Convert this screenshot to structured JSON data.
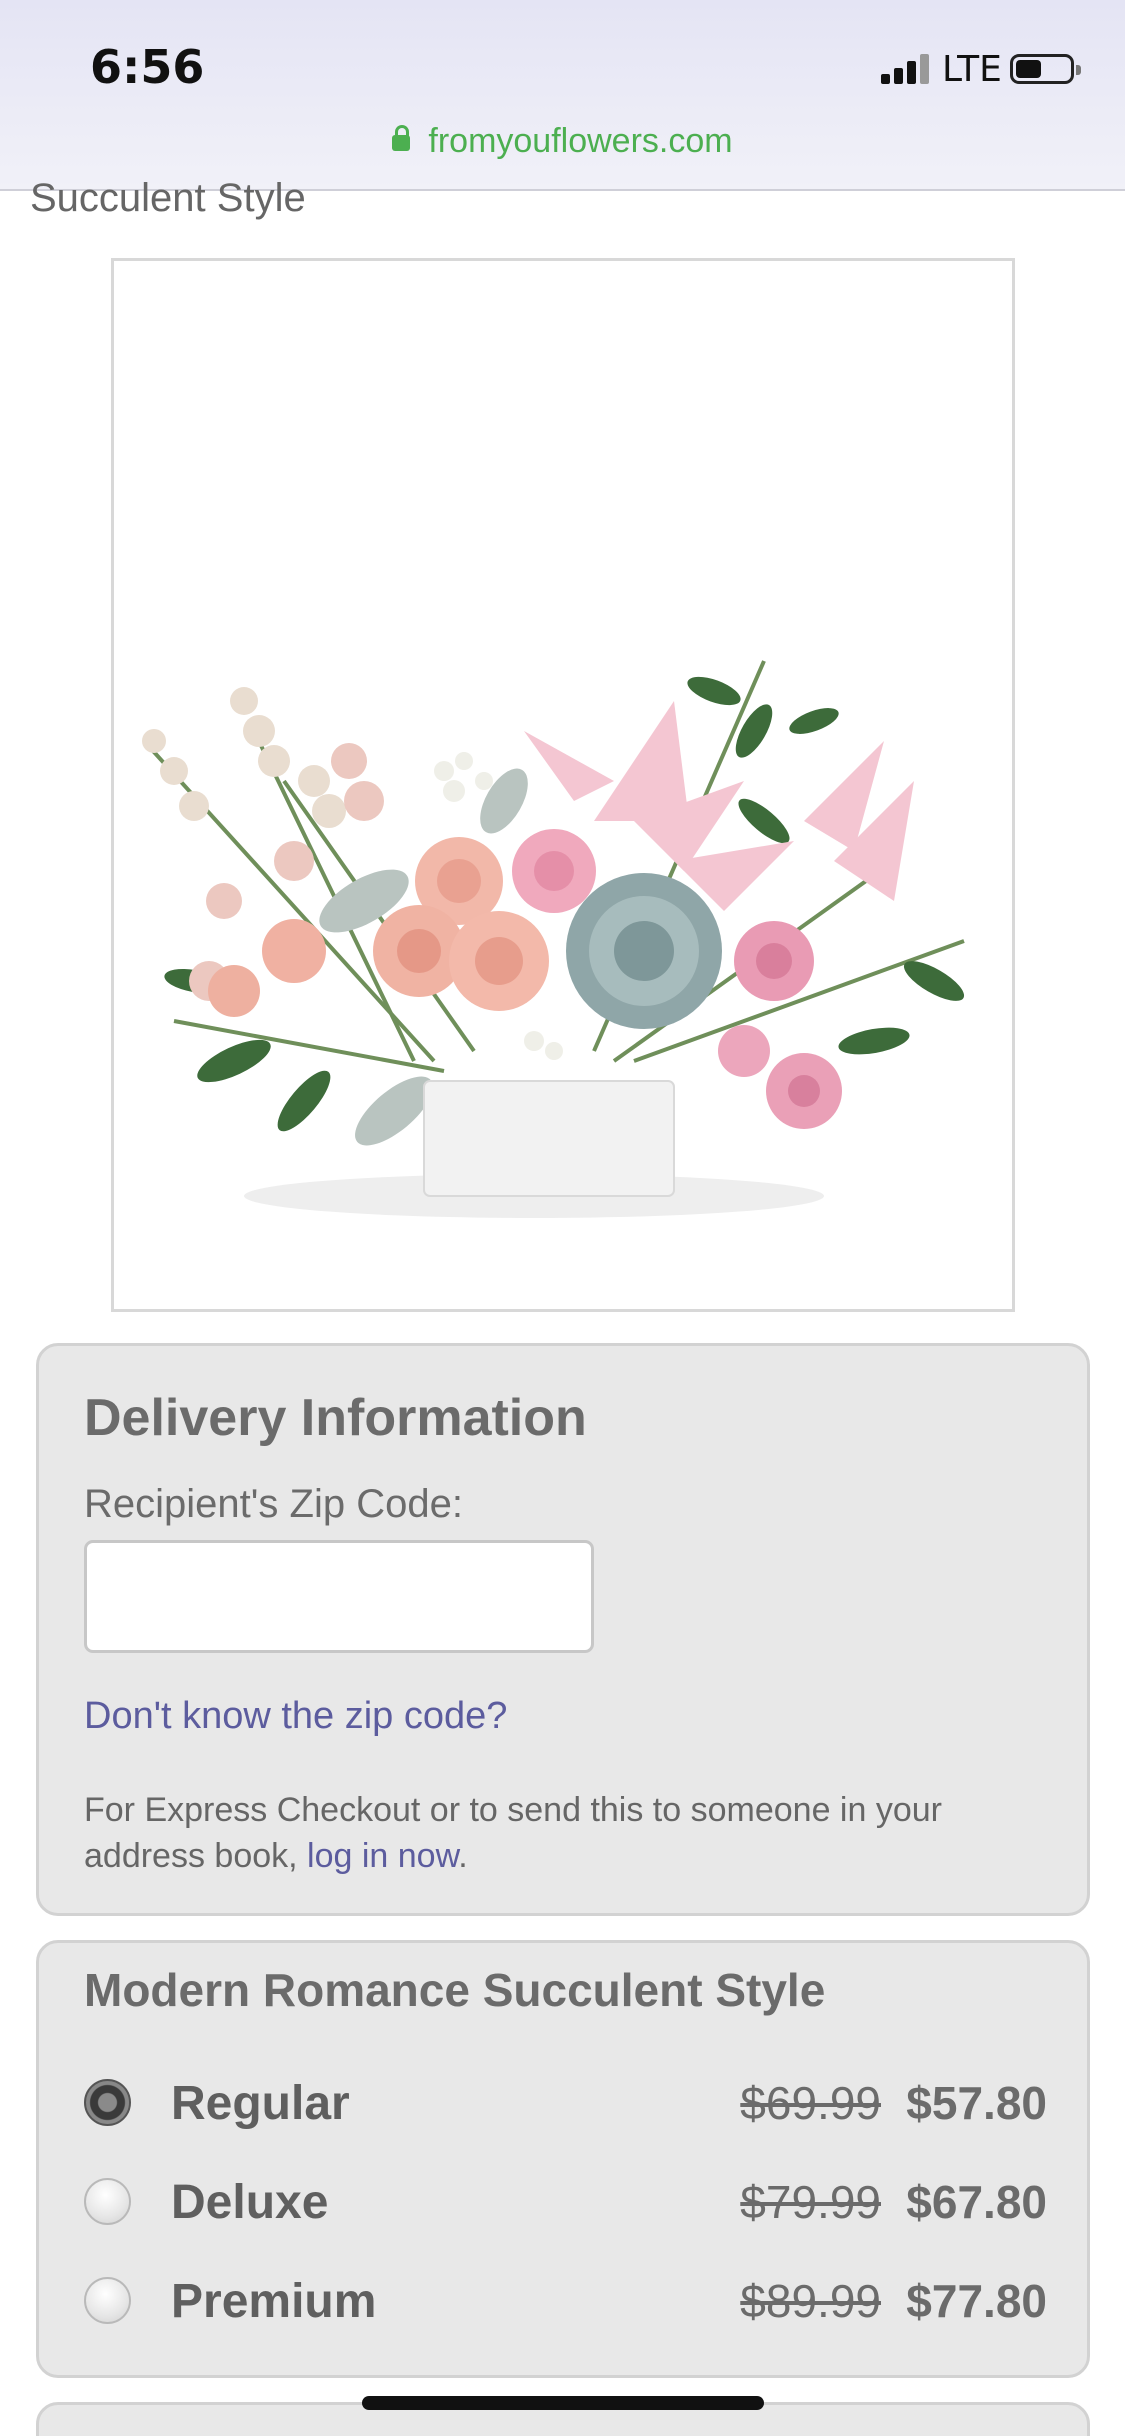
{
  "status_bar": {
    "time": "6:56",
    "network": "LTE"
  },
  "browser": {
    "url": "fromyouflowers.com"
  },
  "page": {
    "partial_title": "Succulent Style"
  },
  "product_image": {
    "alt": "Flower arrangement with pink roses, lilies and succulent in white container"
  },
  "delivery": {
    "heading": "Delivery Information",
    "zip_label": "Recipient's Zip Code:",
    "zip_value": "",
    "zip_help_link": "Don't know the zip code?",
    "express_text": "For Express Checkout or to send this to someone in your address book,",
    "login_link": "log in now",
    "express_end": "."
  },
  "style_options": {
    "heading": "Modern Romance Succulent Style",
    "options": [
      {
        "label": "Regular",
        "old_price": "$69.99",
        "price": "$57.80",
        "selected": true
      },
      {
        "label": "Deluxe",
        "old_price": "$79.99",
        "price": "$67.80",
        "selected": false
      },
      {
        "label": "Premium",
        "old_price": "$89.99",
        "price": "$77.80",
        "selected": false
      }
    ]
  },
  "colors": {
    "link": "#5c5c9e",
    "url_green": "#4caf50",
    "panel_bg": "#e8e8e8"
  }
}
